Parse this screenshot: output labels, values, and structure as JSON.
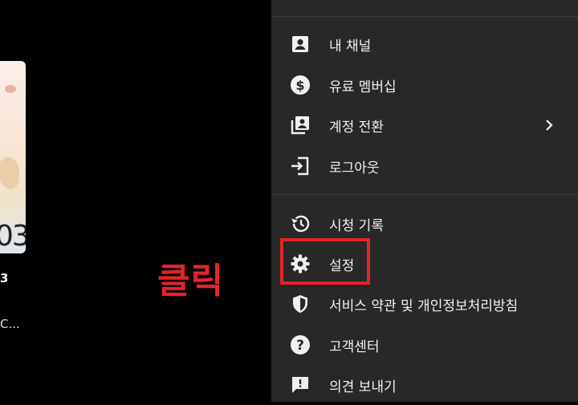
{
  "background": {
    "thumbnail_number": "03",
    "thumbnail_title": "3",
    "thumbnail_subtitle": "C..."
  },
  "annotation": {
    "click_label": "클릭",
    "highlight_color": "#e3242b"
  },
  "menu": {
    "groups": [
      [
        {
          "name": "my-channel",
          "label": "내 채널",
          "icon": "account-box-icon"
        },
        {
          "name": "paid-membership",
          "label": "유료 멤버십",
          "icon": "dollar-circle-icon"
        },
        {
          "name": "switch-account",
          "label": "계정 전환",
          "icon": "switch-account-icon",
          "has_chevron": true
        },
        {
          "name": "logout",
          "label": "로그아웃",
          "icon": "logout-icon"
        }
      ],
      [
        {
          "name": "watch-history",
          "label": "시청 기록",
          "icon": "history-icon"
        },
        {
          "name": "settings",
          "label": "설정",
          "icon": "gear-icon"
        },
        {
          "name": "terms-privacy",
          "label": "서비스 약관 및 개인정보처리방침",
          "icon": "shield-icon"
        },
        {
          "name": "help-center",
          "label": "고객센터",
          "icon": "help-icon"
        },
        {
          "name": "send-feedback",
          "label": "의견 보내기",
          "icon": "feedback-icon"
        }
      ]
    ]
  }
}
